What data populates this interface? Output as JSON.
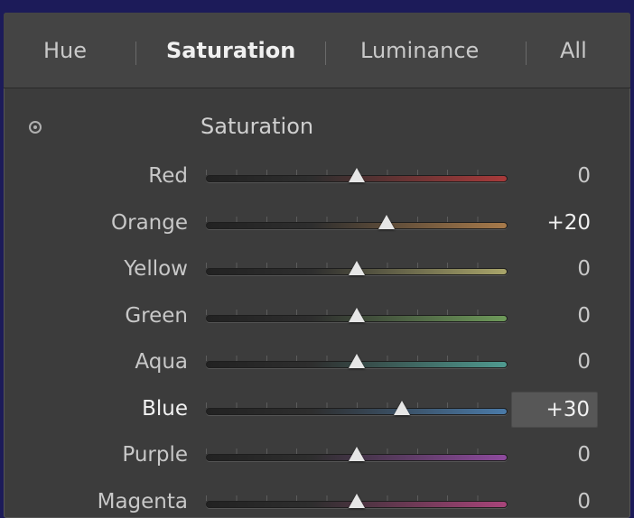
{
  "tabs": [
    {
      "id": "hue",
      "label": "Hue",
      "active": false
    },
    {
      "id": "saturation",
      "label": "Saturation",
      "active": true
    },
    {
      "id": "luminance",
      "label": "Luminance",
      "active": false
    },
    {
      "id": "all",
      "label": "All",
      "active": false
    }
  ],
  "section": {
    "title": "Saturation",
    "target_icon": "target-adjustment-icon"
  },
  "slider_range": [
    -100,
    100
  ],
  "rows": [
    {
      "id": "red",
      "label": "Red",
      "value": 0,
      "display": "0",
      "track_color": "#a83a3a"
    },
    {
      "id": "orange",
      "label": "Orange",
      "value": 20,
      "display": "+20",
      "track_color": "#a77a4a"
    },
    {
      "id": "yellow",
      "label": "Yellow",
      "value": 0,
      "display": "0",
      "track_color": "#a9a56a"
    },
    {
      "id": "green",
      "label": "Green",
      "value": 0,
      "display": "0",
      "track_color": "#6e9a5a"
    },
    {
      "id": "aqua",
      "label": "Aqua",
      "value": 0,
      "display": "0",
      "track_color": "#4f9a90"
    },
    {
      "id": "blue",
      "label": "Blue",
      "value": 30,
      "display": "+30",
      "track_color": "#4a7aa8",
      "active": true
    },
    {
      "id": "purple",
      "label": "Purple",
      "value": 0,
      "display": "0",
      "track_color": "#8e4a9e"
    },
    {
      "id": "magenta",
      "label": "Magenta",
      "value": 0,
      "display": "0",
      "track_color": "#a8447a"
    }
  ]
}
